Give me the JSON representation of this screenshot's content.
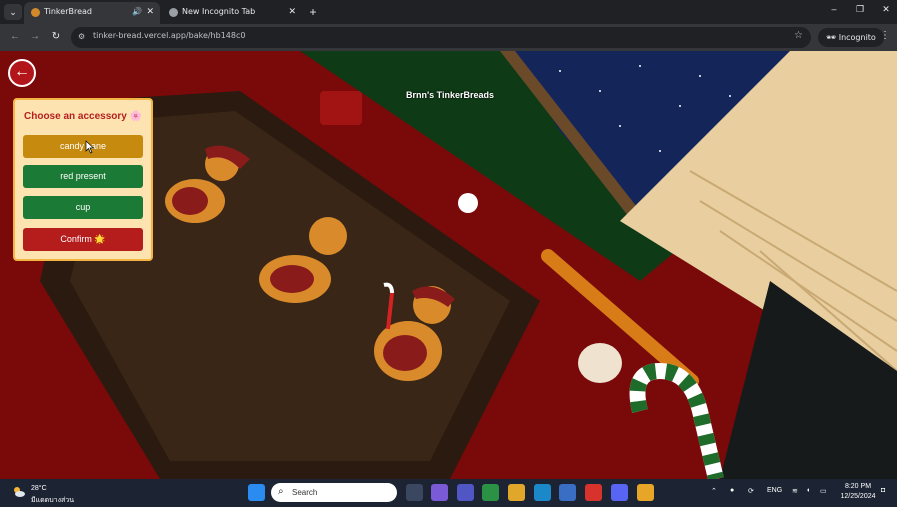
{
  "browser": {
    "tabs": [
      {
        "title": "TinkerBread",
        "active": true,
        "audio": "🔊",
        "close": "✕"
      },
      {
        "title": "New Incognito Tab",
        "active": false,
        "close": "✕"
      }
    ],
    "new_tab": "+",
    "url": "tinker-bread.vercel.app/bake/hb148c0",
    "incognito_label": "Incognito",
    "window_controls": {
      "minimize": "–",
      "maximize": "❐",
      "close": "✕"
    }
  },
  "page": {
    "title": "Brnn's TinkerBreads",
    "back_icon": "arrow-left-icon",
    "accessory_panel": {
      "heading": "Choose an accessory 🌸",
      "options": [
        {
          "label": "candy cane",
          "state": "selected",
          "color": "#c68a0f"
        },
        {
          "label": "red present",
          "color": "#1b7a35"
        },
        {
          "label": "cup",
          "color": "#1b7a35"
        }
      ],
      "confirm_label": "Confirm 🌟",
      "confirm_color": "#b51c1c"
    }
  },
  "taskbar": {
    "weather": {
      "temp": "28°C",
      "desc": "มีแดดบางส่วน"
    },
    "search_placeholder": "Search",
    "language": "ENG",
    "time": "8:20 PM",
    "date": "12/25/2024"
  }
}
